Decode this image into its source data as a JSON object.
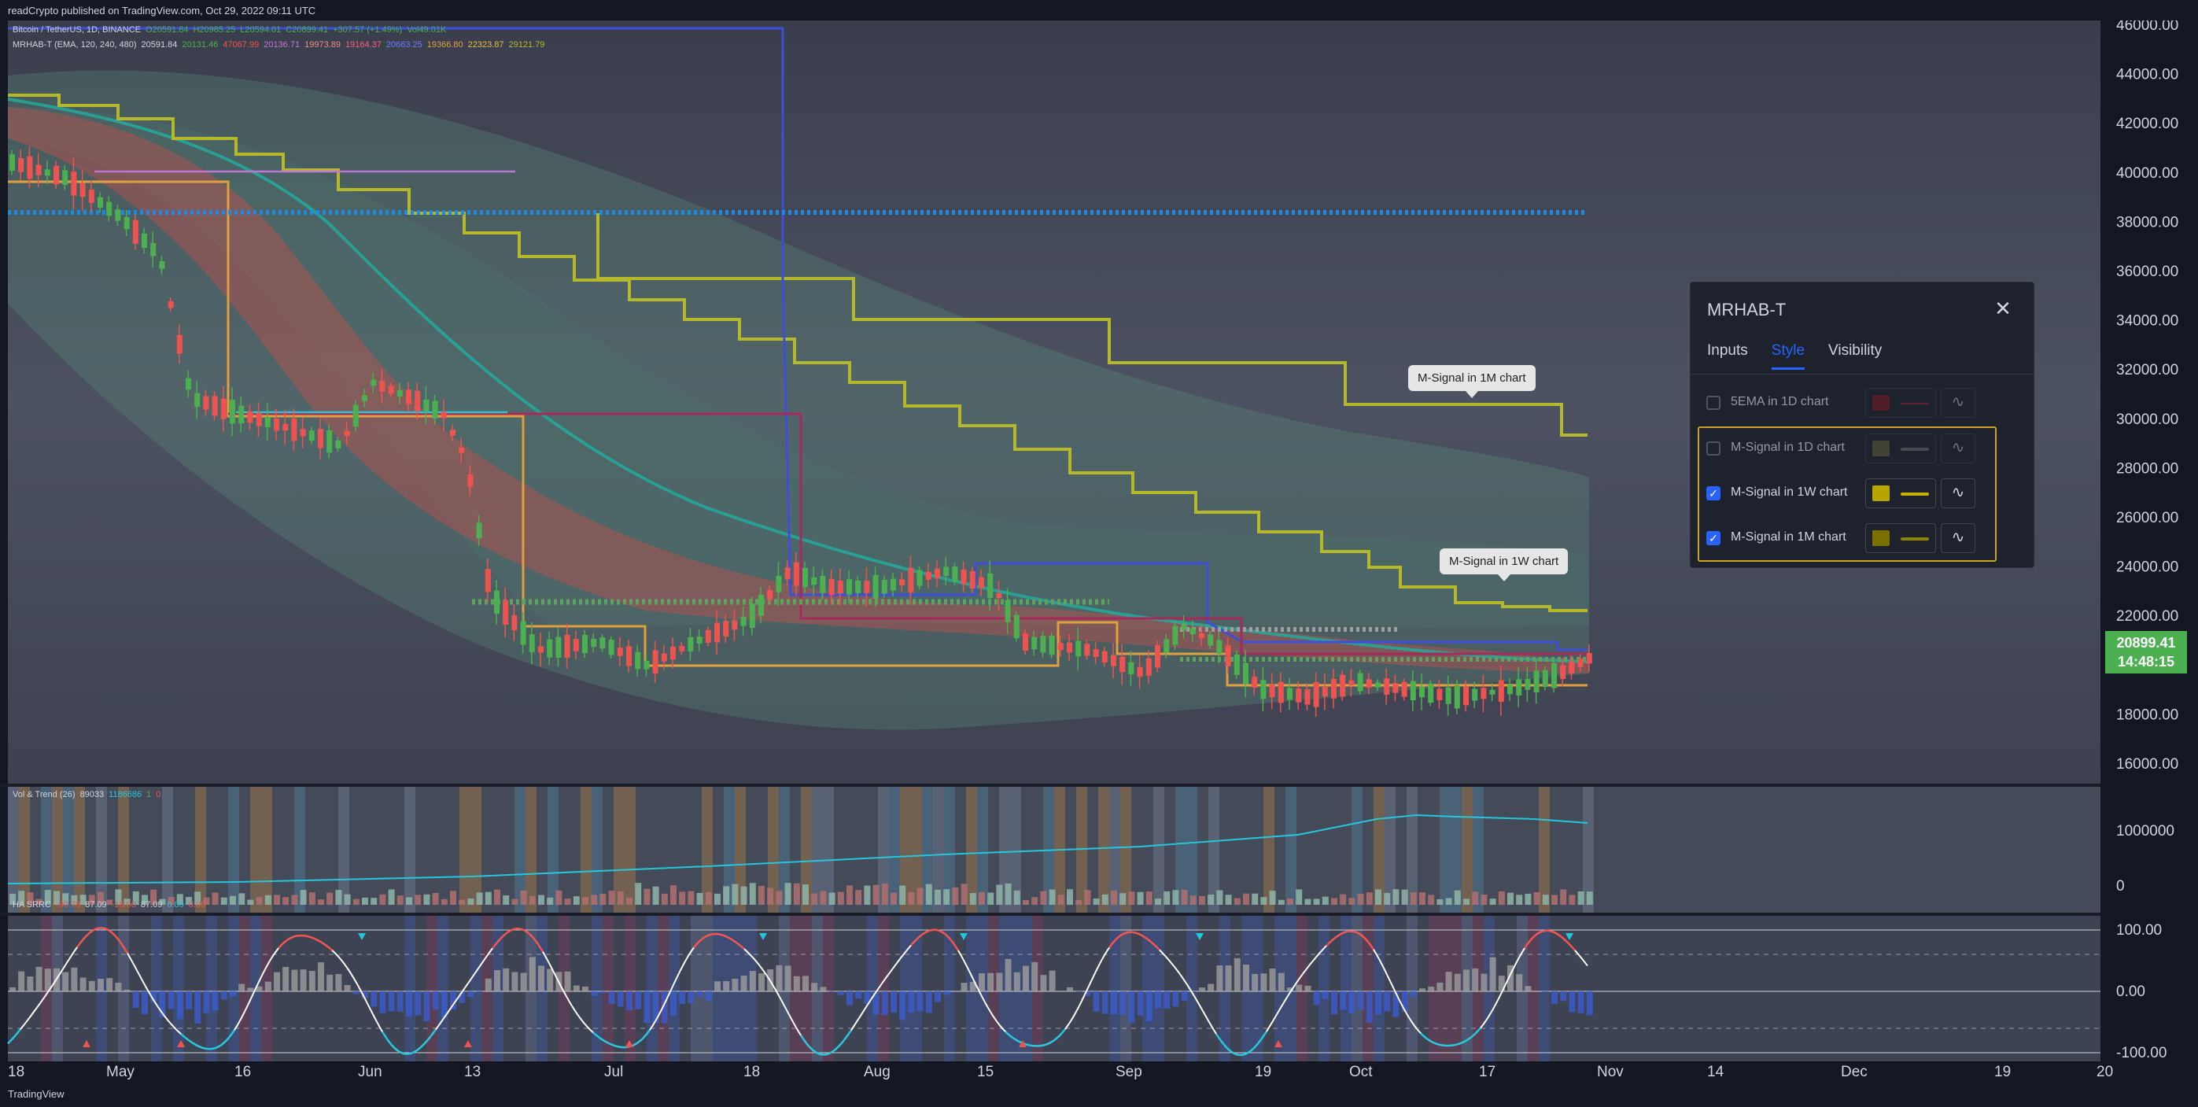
{
  "header": {
    "text": "readCrypto published on TradingView.com, Oct 29, 2022 09:11 UTC"
  },
  "footer": {
    "logo": "TradingView"
  },
  "colors": {
    "background": "#131722",
    "chart_bg": "#4a4f5e",
    "candle_up": "#4caf50",
    "candle_down": "#ef5350",
    "mline_1m": "#b5b82a",
    "mline_1w": "#e0a040",
    "price_box": "#4caf50",
    "accent": "#2962ff"
  },
  "legend": {
    "line1": [
      "Bitcoin / TetherUS, 1D, BINANCE",
      "O20591.84",
      "H20985.25",
      "L20594.01",
      "C20899.41",
      "+307.57 (+1.49%)",
      "Vol49.01K"
    ],
    "line2": [
      "MRHAB-T (EMA, 120, 240, 480)",
      "20591.84",
      "20131.46",
      "",
      "47067.99",
      "",
      "",
      "20136.71",
      "19973.89",
      "19164.37",
      "20663.25",
      "",
      "19366.80",
      "22323.87",
      "29121.79",
      ""
    ],
    "vol_legend": [
      "Vol & Trend (26)",
      "89033",
      "1186686",
      "1",
      "0"
    ],
    "osc_legend": [
      "HA SRRC",
      "-90.78",
      "87.09",
      "-15.00",
      "87.09",
      "0.00",
      "0.00"
    ]
  },
  "price_axis": [
    "46000.00",
    "44000.00",
    "42000.00",
    "40000.00",
    "38000.00",
    "36000.00",
    "34000.00",
    "32000.00",
    "30000.00",
    "28000.00",
    "26000.00",
    "24000.00",
    "22000.00",
    "20000.00",
    "18000.00",
    "16000.00"
  ],
  "vol_axis": [
    "1000000",
    "0"
  ],
  "osc_axis": [
    "100.00",
    "0.00",
    "-100.00"
  ],
  "time_axis": [
    "18",
    "May",
    "16",
    "Jun",
    "13",
    "Jul",
    "18",
    "Aug",
    "15",
    "Sep",
    "19",
    "Oct",
    "17",
    "Nov",
    "14",
    "Dec",
    "19",
    "20"
  ],
  "last_price": {
    "value": "20899.41",
    "countdown": "14:48:15"
  },
  "annotations": {
    "m1": "M-Signal in 1M chart",
    "w1": "M-Signal in 1W chart"
  },
  "dialog": {
    "title": "MRHAB-T",
    "tabs": [
      "Inputs",
      "Style",
      "Visibility"
    ],
    "active_tab": "Style",
    "rows": [
      {
        "label": "5EMA in 1D chart",
        "checked": false,
        "color": "#8b1a22",
        "line_color": "#b0252f"
      },
      {
        "label": "M-Signal in 1D chart",
        "checked": false,
        "color": "#6e6a44",
        "line_color": "#7d7d7d"
      },
      {
        "label": "M-Signal in 1W chart",
        "checked": true,
        "color": "#b7a500",
        "line_color": "#c6b000"
      },
      {
        "label": "M-Signal in 1M chart",
        "checked": true,
        "color": "#7a7000",
        "line_color": "#8d8400"
      }
    ]
  }
}
